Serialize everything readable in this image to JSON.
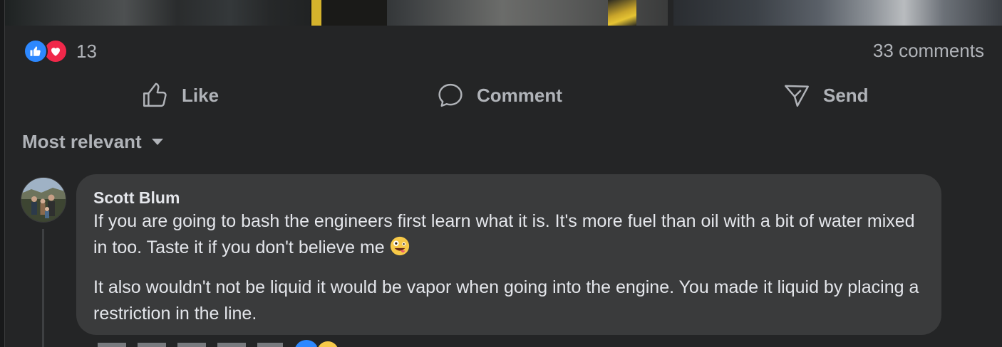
{
  "post": {
    "reactions": {
      "icons": [
        "like-icon",
        "love-icon"
      ],
      "count": "13"
    },
    "comments_count_label": "33 comments",
    "actions": {
      "like_label": "Like",
      "comment_label": "Comment",
      "send_label": "Send"
    }
  },
  "comments_section": {
    "sort_label": "Most relevant",
    "comments": [
      {
        "author": "Scott Blum",
        "paragraphs": [
          "If you are going to bash the engineers first learn what it is. It's more fuel than oil with a bit of water mixed in too. Taste it if you don't believe me",
          "It also wouldn't not be liquid it would be vapor when going into the engine. You made it liquid by placing a restriction in the line."
        ],
        "emoji": "zany-face-icon",
        "reaction_icons": [
          "like-icon",
          "haha-icon"
        ]
      }
    ]
  },
  "colors": {
    "page_background": "#18191a",
    "card_background": "#242526",
    "bubble_background": "#3a3b3c",
    "primary_text": "#e4e6eb",
    "secondary_text": "#b0b3b8",
    "like_blue": "#2d88ff",
    "love_red": "#f0284a"
  }
}
